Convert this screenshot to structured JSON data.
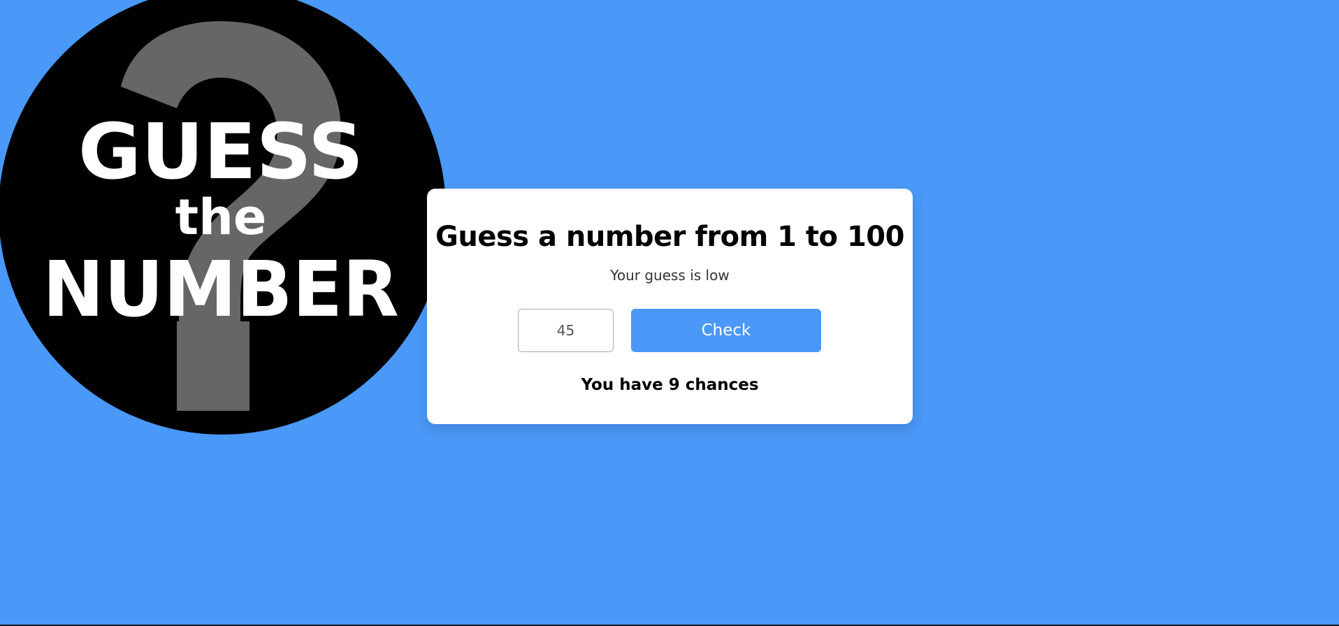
{
  "logo": {
    "line1": "GUESS",
    "line2": "the",
    "line3": "NUMBER"
  },
  "card": {
    "title": "Guess a number from 1 to 100",
    "status": "Your guess is low",
    "input_value": "45",
    "check_label": "Check",
    "chances_text": "You have 9 chances"
  },
  "colors": {
    "background": "#4a98f7",
    "button": "#4a98f7",
    "card": "#ffffff"
  }
}
